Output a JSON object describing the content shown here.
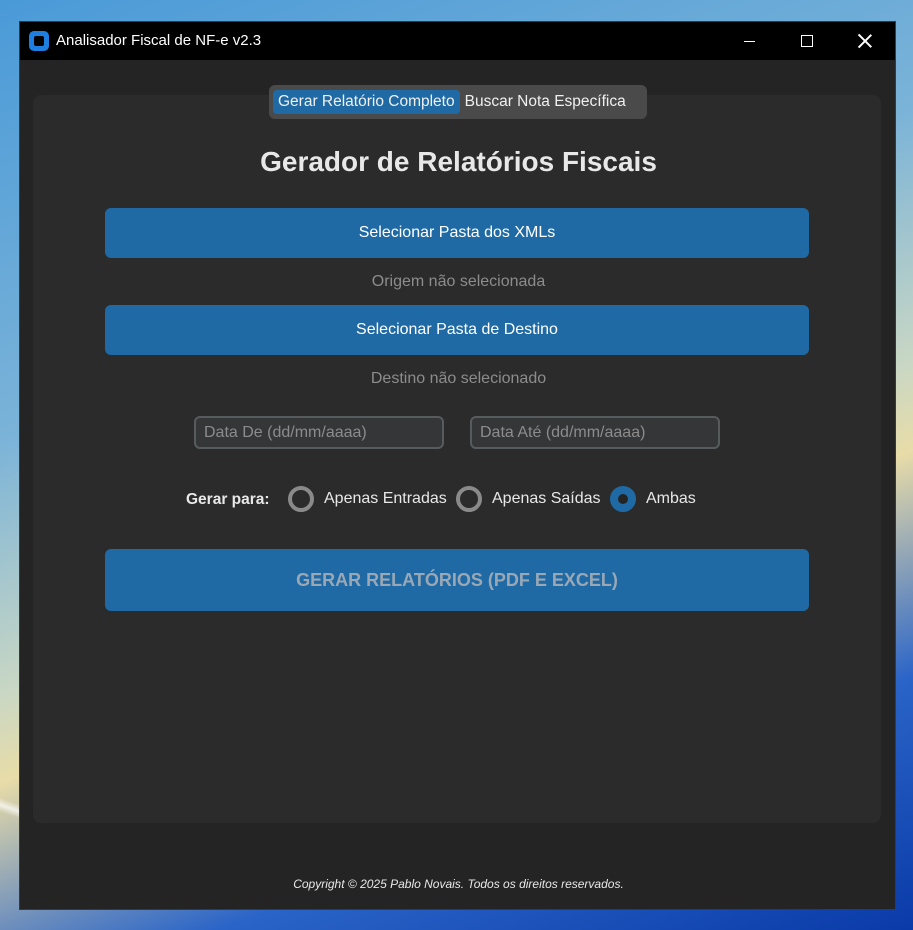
{
  "window": {
    "title": "Analisador Fiscal de NF-e v2.3"
  },
  "tabs": [
    {
      "label": "Gerar Relatório Completo",
      "active": true
    },
    {
      "label": "Buscar Nota Específica",
      "active": false
    }
  ],
  "main": {
    "heading": "Gerador de Relatórios Fiscais",
    "select_source_label": "Selecionar Pasta dos XMLs",
    "source_status": "Origem não selecionada",
    "select_dest_label": "Selecionar Pasta de Destino",
    "dest_status": "Destino não selecionado",
    "date_from_placeholder": "Data De (dd/mm/aaaa)",
    "date_to_placeholder": "Data Até (dd/mm/aaaa)",
    "generate_for_label": "Gerar para:",
    "radio_options": [
      {
        "label": "Apenas Entradas",
        "checked": false
      },
      {
        "label": "Apenas Saídas",
        "checked": false
      },
      {
        "label": "Ambas",
        "checked": true
      }
    ],
    "generate_button_label": "GERAR RELATÓRIOS (PDF E EXCEL)"
  },
  "footer": {
    "copyright": "Copyright © 2025 Pablo Novais. Todos os direitos reservados."
  },
  "colors": {
    "accent": "#1f6aa5",
    "window_bg": "#242424",
    "panel_bg": "#2b2b2b"
  }
}
